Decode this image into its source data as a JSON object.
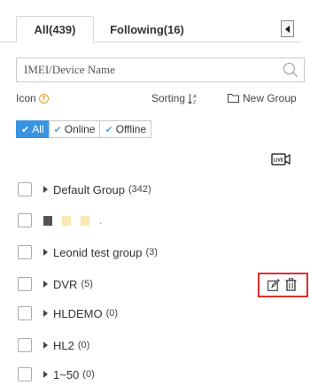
{
  "tabs": [
    {
      "label": "All(439)",
      "active": true
    },
    {
      "label": "Following(16)",
      "active": false
    }
  ],
  "search": {
    "placeholder": "IMEI/Device Name"
  },
  "toolbar": {
    "icon_label": "Icon",
    "help_glyph": "?",
    "sorting_label": "Sorting",
    "new_group_label": "New Group"
  },
  "filters": [
    {
      "label": "All",
      "active": true
    },
    {
      "label": "Online",
      "active": false
    },
    {
      "label": "Offline",
      "active": false
    }
  ],
  "groups": [
    {
      "name": "Default Group",
      "count": "(342)"
    },
    {
      "name": "Leonid test group",
      "count": "(3)"
    },
    {
      "name": "DVR",
      "count": "(5)"
    },
    {
      "name": "HLDEMO",
      "count": "(0)"
    },
    {
      "name": "HL2",
      "count": "(0)"
    },
    {
      "name": "1~50",
      "count": "(0)"
    }
  ],
  "unnamed_row_suffix": ".",
  "icons": {
    "live_label": "LIVE",
    "check_glyph": "✔",
    "colors": {
      "accent_blue": "#3a93e2",
      "highlight_red": "#e02b2b",
      "help_orange": "#e89c2c"
    }
  }
}
